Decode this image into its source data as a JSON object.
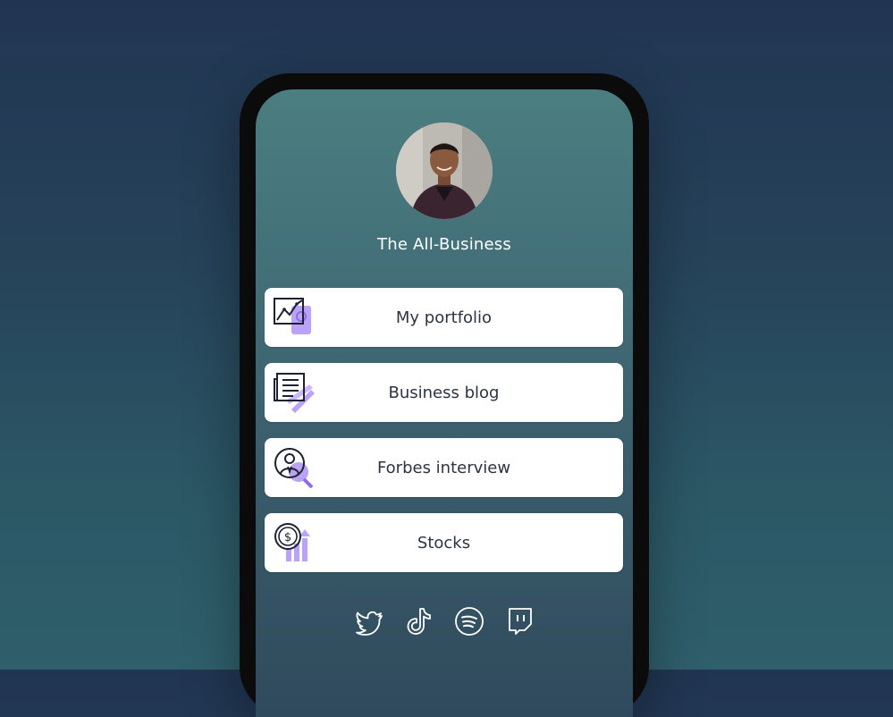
{
  "profile": {
    "name": "The All-Business",
    "avatar": "person-portrait"
  },
  "links": [
    {
      "label": "My portfolio",
      "icon": "chart-tablet-icon"
    },
    {
      "label": "Business blog",
      "icon": "newspaper-pen-icon"
    },
    {
      "label": "Forbes interview",
      "icon": "person-search-icon"
    },
    {
      "label": "Stocks",
      "icon": "dollar-growth-icon"
    }
  ],
  "socials": [
    {
      "name": "Twitter",
      "icon": "twitter-icon"
    },
    {
      "name": "TikTok",
      "icon": "tiktok-icon"
    },
    {
      "name": "Spotify",
      "icon": "spotify-icon"
    },
    {
      "name": "Twitch",
      "icon": "twitch-icon"
    }
  ],
  "colors": {
    "accent": "#a78bfa",
    "card_text": "#2b3440",
    "background_top": "#213552",
    "background_bottom": "#2f5f6b"
  }
}
